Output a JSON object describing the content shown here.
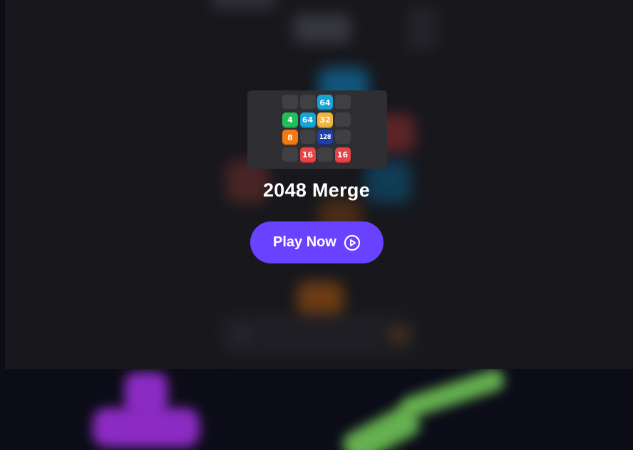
{
  "game": {
    "title": "2048 Merge",
    "play_label": "Play Now",
    "board": [
      [
        "",
        "",
        "64",
        ""
      ],
      [
        "4",
        "64",
        "32",
        ""
      ],
      [
        "8",
        "",
        "128",
        ""
      ],
      [
        "",
        "16",
        "",
        "16"
      ]
    ],
    "tile_colors": {
      "": "#3f3f44",
      "4": "#1fbf5a",
      "8": "#f07a16",
      "16": "#e9434a",
      "32": "#f2b441",
      "64": "#14a4d8",
      "128": "#1d3fa6"
    }
  },
  "colors": {
    "accent": "#6842ff",
    "background": "#17171c"
  }
}
